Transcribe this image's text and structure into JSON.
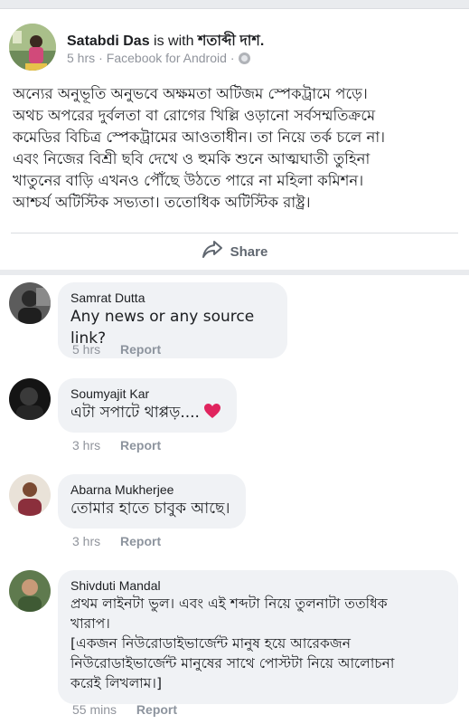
{
  "post": {
    "author": "Satabdi Das",
    "with_text": "is with",
    "tagged": "শতাব্দী দাশ.",
    "time": "5 hrs",
    "source": "Facebook for Android",
    "separator": "·",
    "body_lines": [
      "অন্যের অনুভূতি অনুভবে অক্ষমতা অটিজম স্পেকট্রামে পড়ে।",
      "অথচ অপরের দুর্বলতা বা রোগের খিল্লি ওড়ানো সর্বসম্মতিক্রমে",
      "কমেডির বিচিত্র স্পেকট্রামের আওতাধীন। তা নিয়ে তর্ক চলে না।",
      "এবং নিজের বিশ্রী ছবি দেখে ও হুমকি শুনে আত্মঘাতী তুহিনা",
      "খাতুনের বাড়ি এখনও পৌঁছে উঠতে পারে না মহিলা কমিশন।",
      "আশ্চর্য অটিস্টিক সভ্যতা। ততোধিক অটিস্টিক রাষ্ট্র।"
    ],
    "share_label": "Share"
  },
  "comments": [
    {
      "name": "Samrat Dutta",
      "lines": [
        "Any news or any source link?"
      ],
      "time": "5 hrs",
      "report": "Report"
    },
    {
      "name": "Soumyajit Kar",
      "lines": [
        "এটা সপাটে থাপ্পড়...."
      ],
      "time": "3 hrs",
      "report": "Report"
    },
    {
      "name": "Abarna Mukherjee",
      "lines": [
        "তোমার হাতে চাবুক আছে।"
      ],
      "time": "3 hrs",
      "report": "Report"
    },
    {
      "name": "Shivduti Mandal",
      "lines": [
        "প্রথম লাইনটা ভুল। এবং এই শব্দটা নিয়ে তুলনাটা ততধিক",
        "খারাপ।",
        "[একজন নিউরোডাইভার্জেন্ট মানুষ হয়ে আরেকজন",
        "নিউরোডাইভার্জেন্ট মানুষের সাথে পোস্টটা নিয়ে আলোচনা",
        "করেই লিখলাম।]"
      ],
      "time": "55 mins",
      "report": "Report"
    }
  ],
  "colors": {
    "text": "#1c1e21",
    "meta": "#90949c",
    "bubble": "#f0f2f5",
    "divider": "#dadde1",
    "heart": "#e0245e"
  },
  "icons": {
    "globe": "globe-icon",
    "share": "share-arrow-icon",
    "heart": "heart-emoji-icon"
  }
}
